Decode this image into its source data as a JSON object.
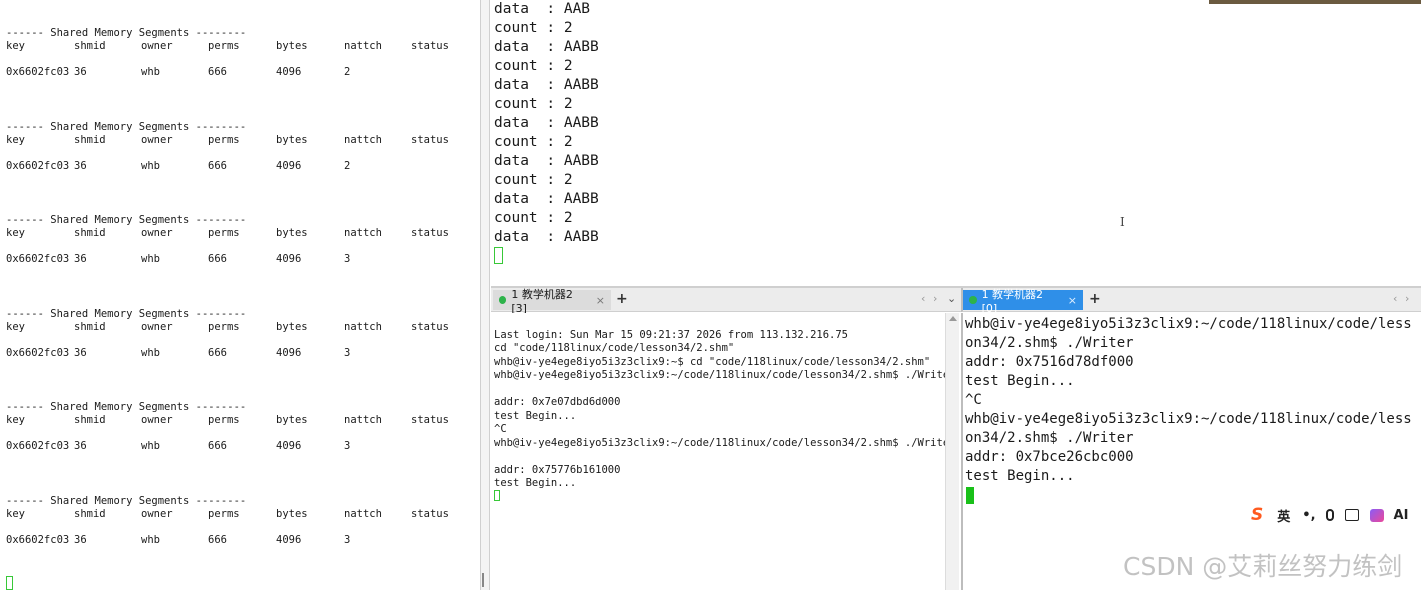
{
  "left_terminal": {
    "header": "------ Shared Memory Segments --------",
    "columns": [
      "key",
      "shmid",
      "owner",
      "perms",
      "bytes",
      "nattch",
      "status"
    ],
    "blocks": [
      {
        "row": [
          "0x6602fc03",
          "36",
          "whb",
          "666",
          "4096",
          "2",
          ""
        ]
      },
      {
        "row": [
          "0x6602fc03",
          "36",
          "whb",
          "666",
          "4096",
          "2",
          ""
        ]
      },
      {
        "row": [
          "0x6602fc03",
          "36",
          "whb",
          "666",
          "4096",
          "3",
          ""
        ]
      },
      {
        "row": [
          "0x6602fc03",
          "36",
          "whb",
          "666",
          "4096",
          "3",
          ""
        ]
      },
      {
        "row": [
          "0x6602fc03",
          "36",
          "whb",
          "666",
          "4096",
          "3",
          ""
        ]
      },
      {
        "row": [
          "0x6602fc03",
          "36",
          "whb",
          "666",
          "4096",
          "3",
          ""
        ]
      }
    ]
  },
  "top_right_terminal": {
    "lines": [
      "data  : AAB",
      "count : 2",
      "data  : AABB",
      "count : 2",
      "data  : AABB",
      "count : 2",
      "data  : AABB",
      "count : 2",
      "data  : AABB",
      "count : 2",
      "data  : AABB",
      "count : 2",
      "data  : AABB"
    ],
    "text_cursor_glyph": "I"
  },
  "bottom_left_tab": {
    "label": "1 教学机器2 [3]",
    "close": "×",
    "add": "+",
    "nav_prev": "‹",
    "nav_next": "›",
    "nav_menu": "⌄"
  },
  "bottom_right_tab": {
    "label": "1 教学机器2 [0]",
    "close": "×",
    "add": "+",
    "nav_prev": "‹",
    "nav_next": "›"
  },
  "bottom_left_terminal": {
    "lines": [
      "",
      "Last login: Sun Mar 15 09:21:37 2026 from 113.132.216.75",
      "cd \"code/118linux/code/lesson34/2.shm\"",
      "whb@iv-ye4ege8iyo5i3z3clix9:~$ cd \"code/118linux/code/lesson34/2.shm\"",
      "whb@iv-ye4ege8iyo5i3z3clix9:~/code/118linux/code/lesson34/2.shm$ ./Writer",
      "",
      "addr: 0x7e07dbd6d000",
      "test Begin...",
      "^C",
      "whb@iv-ye4ege8iyo5i3z3clix9:~/code/118linux/code/lesson34/2.shm$ ./Writer",
      "",
      "addr: 0x75776b161000",
      "test Begin..."
    ]
  },
  "bottom_right_terminal": {
    "lines": [
      "whb@iv-ye4ege8iyo5i3z3clix9:~/code/118linux/code/less",
      "on34/2.shm$ ./Writer",
      "addr: 0x7516d78df000",
      "test Begin...",
      "^C",
      "whb@iv-ye4ege8iyo5i3z3clix9:~/code/118linux/code/less",
      "on34/2.shm$ ./Writer",
      "addr: 0x7bce26cbc000",
      "test Begin..."
    ]
  },
  "ime_toolbar": {
    "logo": "S",
    "lang": "英",
    "punct": "•,",
    "mic": "🎙",
    "keyboard": "⌨",
    "skin": "👕",
    "ai": "AI"
  },
  "watermark": "CSDN @艾莉丝努力练剑",
  "colors": {
    "tab_active": "#2f8fe8",
    "cursor_green": "#19c019",
    "dot_green": "#2db34a",
    "ime_orange": "#ff5a1f"
  }
}
